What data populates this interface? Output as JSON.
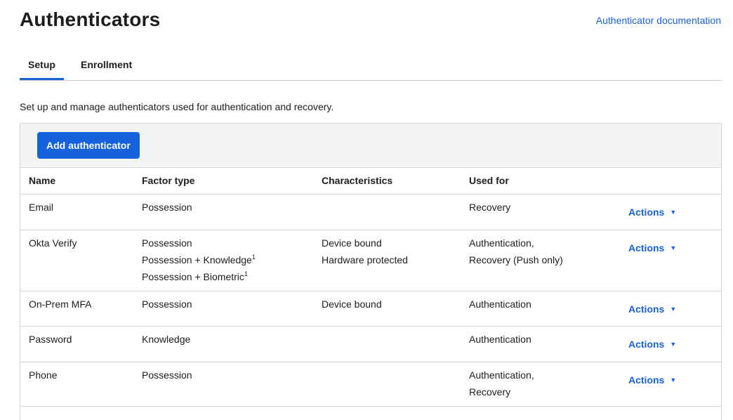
{
  "header": {
    "title": "Authenticators",
    "doc_link": "Authenticator documentation"
  },
  "tabs": [
    {
      "label": "Setup",
      "active": true
    },
    {
      "label": "Enrollment",
      "active": false
    }
  ],
  "intro": "Set up and manage authenticators used for authentication and recovery.",
  "toolbar": {
    "add_label": "Add authenticator"
  },
  "table": {
    "columns": [
      "Name",
      "Factor type",
      "Characteristics",
      "Used for"
    ],
    "actions_label": "Actions",
    "rows": [
      {
        "name": "Email",
        "factor": [
          "Possession"
        ],
        "chars": [],
        "used": [
          "Recovery"
        ]
      },
      {
        "name": "Okta Verify",
        "factor": [
          "Possession",
          "Possession + Knowledge",
          "Possession + Biometric"
        ],
        "chars": [
          "Device bound",
          "Hardware protected"
        ],
        "used": [
          "Authentication,",
          "Recovery (Push only)"
        ]
      },
      {
        "name": "On-Prem MFA",
        "factor": [
          "Possession"
        ],
        "chars": [
          "Device bound"
        ],
        "used": [
          "Authentication"
        ]
      },
      {
        "name": "Password",
        "factor": [
          "Knowledge"
        ],
        "chars": [],
        "used": [
          "Authentication"
        ]
      },
      {
        "name": "Phone",
        "factor": [
          "Possession"
        ],
        "chars": [],
        "used": [
          "Authentication,",
          "Recovery"
        ]
      }
    ],
    "footnote_mark": "1"
  },
  "colors": {
    "accent": "#1662dd",
    "text": "#1d1d21",
    "border": "#d7d7dc",
    "panel_bg": "#f4f4f4"
  }
}
